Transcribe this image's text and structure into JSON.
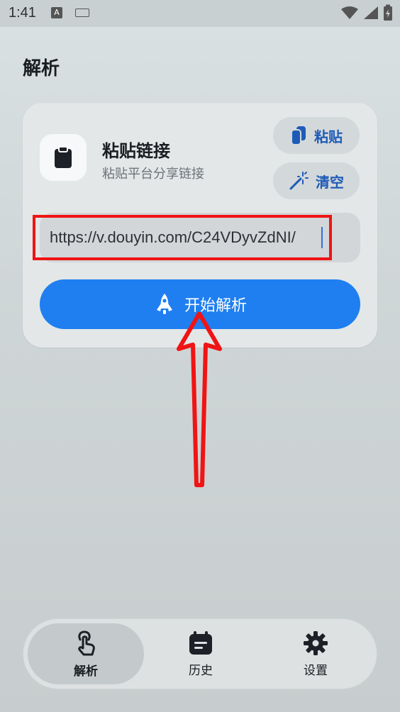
{
  "status": {
    "time": "1:41",
    "a_badge": "A"
  },
  "header": {
    "title": "解析"
  },
  "card": {
    "title": "粘贴链接",
    "subtitle": "粘贴平台分享链接",
    "paste_label": "粘贴",
    "clear_label": "清空",
    "url_value": "https://v.douyin.com/C24VDyvZdNI/",
    "start_label": "开始解析"
  },
  "nav": {
    "items": [
      {
        "label": "解析",
        "icon": "touch-hand-icon",
        "active": true
      },
      {
        "label": "历史",
        "icon": "history-calendar-icon",
        "active": false
      },
      {
        "label": "设置",
        "icon": "gear-icon",
        "active": false
      }
    ]
  },
  "colors": {
    "accent": "#1f7ff0",
    "pill_text": "#1e5bb8",
    "annotation": "#f01414"
  }
}
